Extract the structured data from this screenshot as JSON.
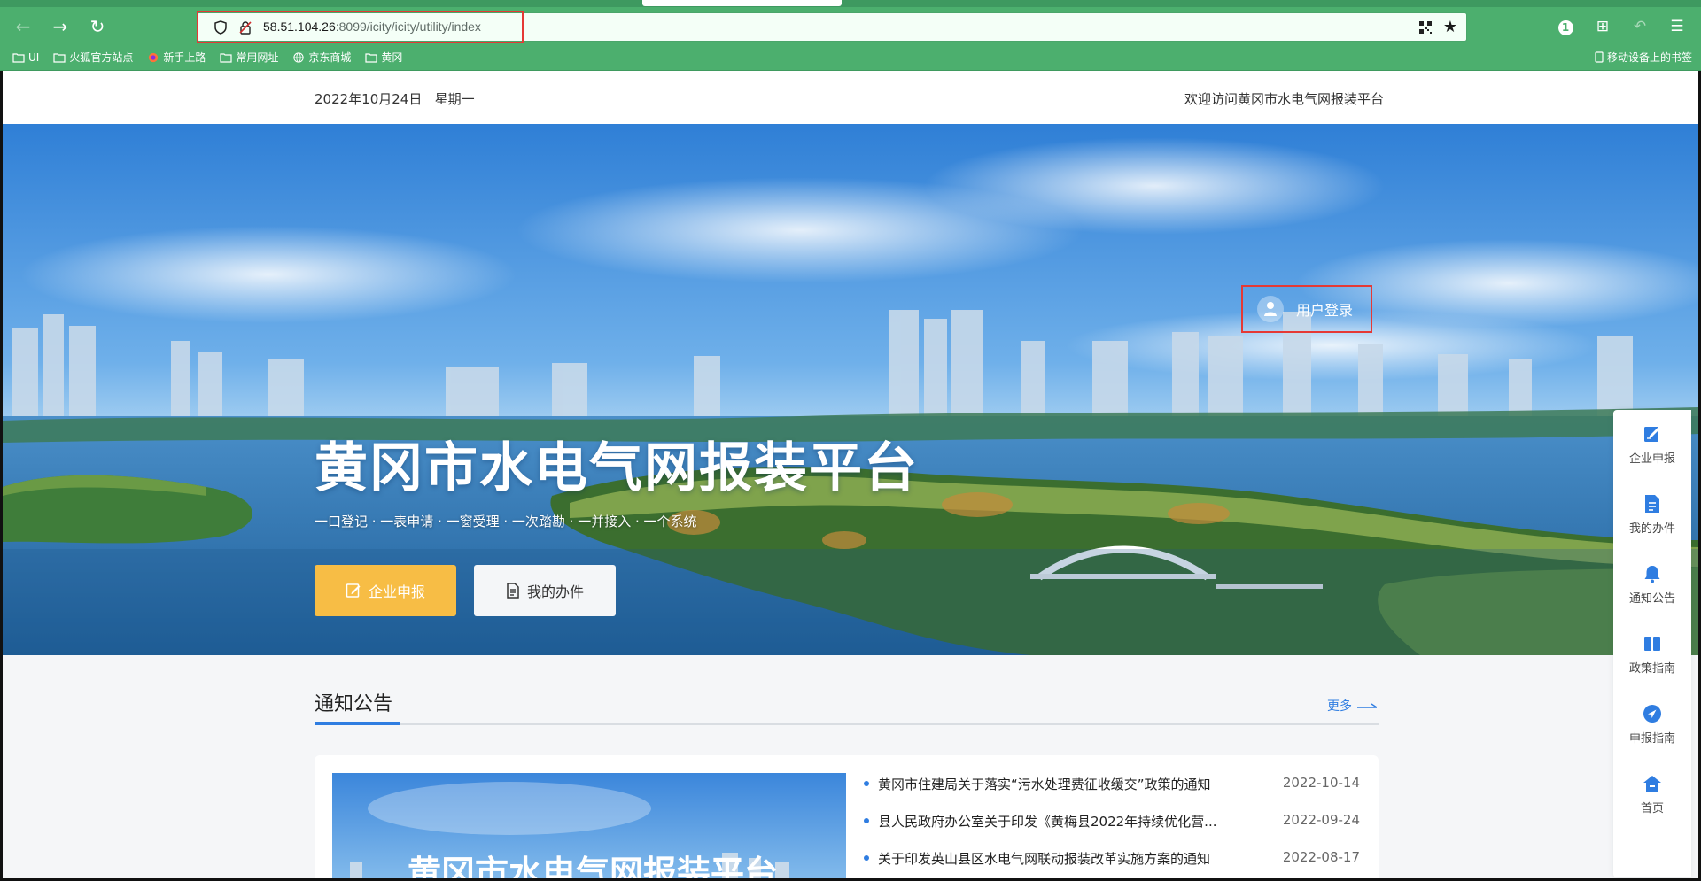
{
  "browser": {
    "url_host": "58.51.104.26",
    "url_rest": ":8099/icity/icity/utility/index",
    "bookmarks": [
      "UI",
      "火狐官方站点",
      "新手上路",
      "常用网址",
      "京东商城",
      "黄冈"
    ],
    "mobile_bookmarks": "移动设备上的书签",
    "badge": "1"
  },
  "topbar": {
    "date": "2022年10月24日",
    "weekday": "星期一",
    "welcome": "欢迎访问黄冈市水电气网报装平台"
  },
  "hero": {
    "login_label": "用户登录",
    "title": "黄冈市水电气网报装平台",
    "slogan": "一口登记 · 一表申请 · 一窗受理 · 一次踏勘 · 一并接入 · 一个系统",
    "btn_enterprise": "企业申报",
    "btn_mine": "我的办件"
  },
  "notice": {
    "title": "通知公告",
    "more": "更多",
    "image_title": "黄冈市水电气网报装平台",
    "items": [
      {
        "text": "黄冈市住建局关于落实“污水处理费征收缓交”政策的通知",
        "date": "2022-10-14"
      },
      {
        "text": "县人民政府办公室关于印发《黄梅县2022年持续优化营...",
        "date": "2022-09-24"
      },
      {
        "text": "关于印发英山县区水电气网联动报装改革实施方案的通知",
        "date": "2022-08-17"
      }
    ]
  },
  "sidenav": [
    {
      "label": "企业申报",
      "icon": "edit-icon"
    },
    {
      "label": "我的办件",
      "icon": "document-icon"
    },
    {
      "label": "通知公告",
      "icon": "bell-icon"
    },
    {
      "label": "政策指南",
      "icon": "book-icon"
    },
    {
      "label": "申报指南",
      "icon": "navigation-icon"
    },
    {
      "label": "首页",
      "icon": "home-icon"
    }
  ],
  "colors": {
    "browser_green": "#4caf6e",
    "accent_blue": "#2f7de1",
    "enterprise_yellow": "#f7bd45",
    "highlight_red": "#e53935"
  }
}
